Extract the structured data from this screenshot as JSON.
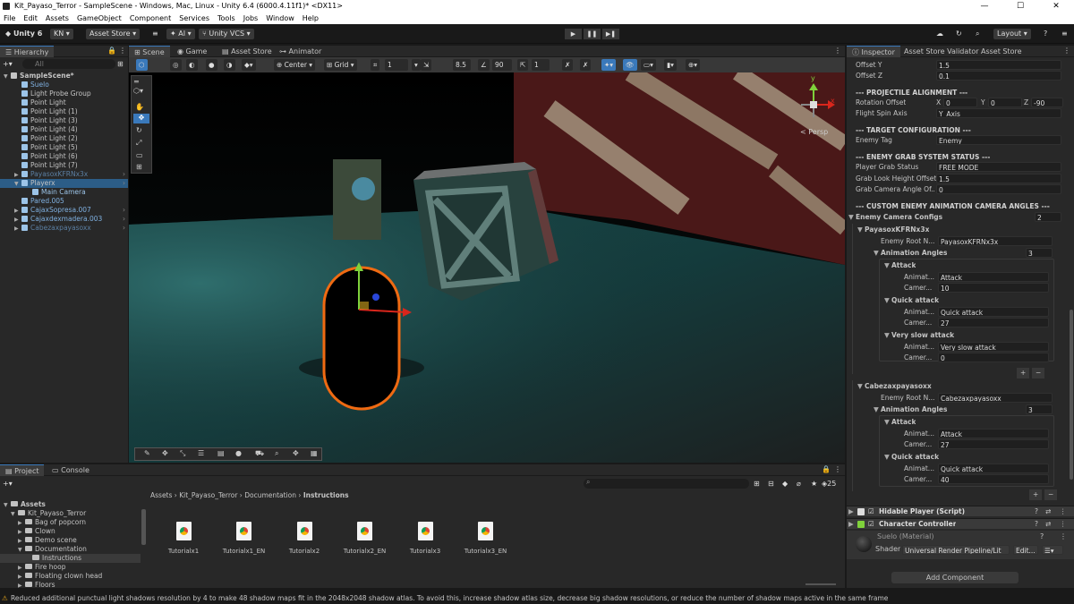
{
  "window": {
    "title": "Kit_Payaso_Terror - SampleScene - Windows, Mac, Linux - Unity 6.4 (6000.4.11f1)* <DX11>",
    "min": "—",
    "max": "☐",
    "close": "✕"
  },
  "menu": [
    "File",
    "Edit",
    "Assets",
    "GameObject",
    "Component",
    "Services",
    "Tools",
    "Jobs",
    "Window",
    "Help"
  ],
  "toolbar": {
    "unity": "Unity 6",
    "account": "KN",
    "asset_store": "Asset Store",
    "ai": "AI",
    "vcs": "Unity VCS",
    "layout": "Layout"
  },
  "hierarchy": {
    "tab": "Hierarchy",
    "search_placeholder": "All",
    "items": [
      {
        "label": "SampleScene*",
        "indent": 0
      },
      {
        "label": "Suelo",
        "indent": 1
      },
      {
        "label": "Light Probe Group",
        "indent": 1
      },
      {
        "label": "Point Light",
        "indent": 1
      },
      {
        "label": "Point Light (1)",
        "indent": 1
      },
      {
        "label": "Point Light (3)",
        "indent": 1
      },
      {
        "label": "Point Light (4)",
        "indent": 1
      },
      {
        "label": "Point Light (2)",
        "indent": 1
      },
      {
        "label": "Point Light (5)",
        "indent": 1
      },
      {
        "label": "Point Light (6)",
        "indent": 1
      },
      {
        "label": "Point Light (7)",
        "indent": 1
      },
      {
        "label": "PayasoxKFRNx3x",
        "indent": 1
      },
      {
        "label": "Playerx",
        "indent": 1
      },
      {
        "label": "Main Camera",
        "indent": 2
      },
      {
        "label": "Pared.005",
        "indent": 1
      },
      {
        "label": "CajaxSopresa.007",
        "indent": 1
      },
      {
        "label": "Cajaxdexmadera.003",
        "indent": 1
      },
      {
        "label": "Cabezaxpayasoxx",
        "indent": 1
      }
    ]
  },
  "scene": {
    "tabs": [
      "Scene",
      "Game",
      "Asset Store",
      "Animator"
    ],
    "pivot": "Center",
    "grid": "Grid",
    "grid_size": "1",
    "snap_val": "8.5",
    "angle": "90",
    "scale": "1",
    "persp": "< Persp",
    "axis_y": "y",
    "axis_x": "x"
  },
  "inspector": {
    "tabs": [
      "Inspector",
      "Asset Store Validator",
      "Asset Store Uploader"
    ],
    "offset_y": {
      "label": "Offset Y",
      "value": "1.5"
    },
    "offset_z": {
      "label": "Offset Z",
      "value": "0.1"
    },
    "projectile_header": "--- PROJECTILE ALIGNMENT ---",
    "rotation_offset": {
      "label": "Rotation Offset",
      "x": "0",
      "y": "0",
      "z": "-90"
    },
    "flight_spin": {
      "label": "Flight Spin Axis",
      "value": "Y_Axis"
    },
    "target_header": "--- TARGET CONFIGURATION ---",
    "enemy_tag": {
      "label": "Enemy Tag",
      "value": "Enemy"
    },
    "grab_header": "--- ENEMY GRAB SYSTEM STATUS ---",
    "grab_status": {
      "label": "Player Grab Status",
      "value": "FREE MODE"
    },
    "grab_height": {
      "label": "Grab Look Height Offset",
      "value": "1.5"
    },
    "grab_cam": {
      "label": "Grab Camera Angle Of...",
      "value": "0"
    },
    "custom_header": "--- CUSTOM ENEMY ANIMATION CAMERA ANGLES ---",
    "enemy_configs": {
      "label": "Enemy Camera Configs",
      "value": "2"
    },
    "enemy1": {
      "name": "PayasoxKFRNx3x",
      "root_label": "Enemy Root N...",
      "root_value": "PayasoxKFRNx3x",
      "angles_label": "Animation Angles",
      "angles_value": "3",
      "entries": [
        {
          "title": "Attack",
          "anim": "Attack",
          "cam": "10"
        },
        {
          "title": "Quick attack",
          "anim": "Quick attack",
          "cam": "27"
        },
        {
          "title": "Very slow attack",
          "anim": "Very slow attack",
          "cam": "0"
        }
      ]
    },
    "enemy2": {
      "name": "Cabezaxpayasoxx",
      "root_label": "Enemy Root N...",
      "root_value": "Cabezaxpayasoxx",
      "angles_label": "Animation Angles",
      "angles_value": "3",
      "entries": [
        {
          "title": "Attack",
          "anim": "Attack",
          "cam": "27"
        },
        {
          "title": "Quick attack",
          "anim": "Quick attack",
          "cam": "40"
        }
      ]
    },
    "anim_label": "Animat...",
    "cam_label": "Camer...",
    "hidable": "Hidable Player (Script)",
    "char_ctrl": "Character Controller",
    "material": "Suelo (Material)",
    "shader_label": "Shader",
    "shader_value": "Universal Render Pipeline/Lit",
    "edit": "Edit...",
    "add_component": "Add Component"
  },
  "project": {
    "tabs": [
      "Project",
      "Console"
    ],
    "tree": [
      {
        "label": "Assets",
        "indent": 0
      },
      {
        "label": "Kit_Payaso_Terror",
        "indent": 1
      },
      {
        "label": "Bag of popcorn",
        "indent": 2
      },
      {
        "label": "Clown",
        "indent": 2
      },
      {
        "label": "Demo scene",
        "indent": 2
      },
      {
        "label": "Documentation",
        "indent": 2
      },
      {
        "label": "Instructions",
        "indent": 3
      },
      {
        "label": "Fire hoop",
        "indent": 2
      },
      {
        "label": "Floating clown head",
        "indent": 2
      },
      {
        "label": "Floors",
        "indent": 2
      }
    ],
    "breadcrumb": [
      "Assets",
      "Kit_Payaso_Terror",
      "Documentation",
      "Instructions"
    ],
    "files": [
      "Tutorialx1",
      "Tutorialx1_EN",
      "Tutorialx2",
      "Tutorialx2_EN",
      "Tutorialx3",
      "Tutorialx3_EN"
    ],
    "count": "25"
  },
  "status": "Reduced additional punctual light shadows resolution by 4 to make 48 shadow maps fit in the 2048x2048 shadow atlas. To avoid this, increase shadow atlas size, decrease big shadow resolutions, or reduce the number of shadow maps active in the same frame"
}
